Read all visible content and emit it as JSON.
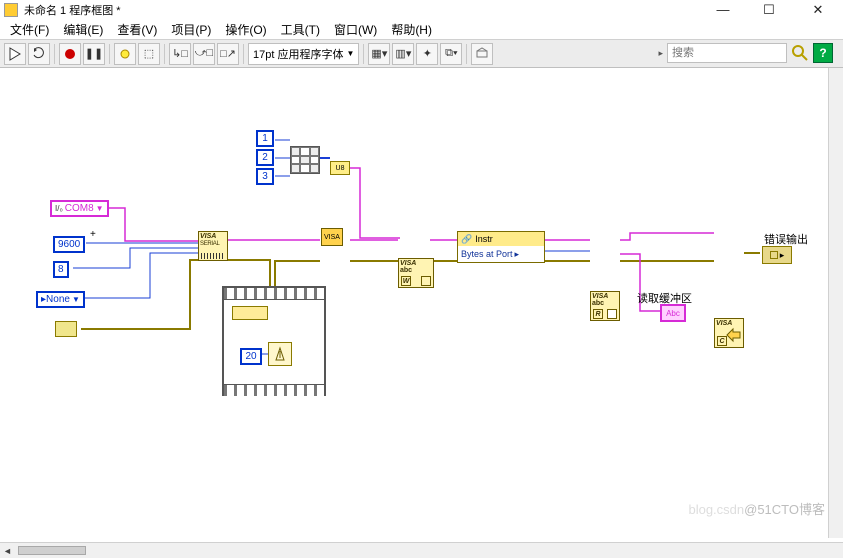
{
  "window": {
    "title": "未命名 1 程序框图 *",
    "min": "—",
    "max": "☐",
    "close": "✕"
  },
  "menu": {
    "file": "文件(F)",
    "edit": "编辑(E)",
    "view": "查看(V)",
    "project": "项目(P)",
    "operate": "操作(O)",
    "tools": "工具(T)",
    "window": "窗口(W)",
    "help": "帮助(H)"
  },
  "toolbar": {
    "font_selector": "17pt 应用程序字体",
    "search_placeholder": "搜索",
    "help_icon": "?"
  },
  "diagram": {
    "resource_control": {
      "prefix": "I/₀",
      "value": "COM8"
    },
    "baud_control": {
      "value": "9600"
    },
    "databits_control": {
      "value": "8"
    },
    "parity_control": {
      "value": "None"
    },
    "array_consts": [
      "1",
      "2",
      "3"
    ],
    "wait_ms": "20",
    "instr_header": "Instr",
    "instr_body": "Bytes at Port",
    "visa_label": "VISA",
    "visa_serial_sub": "SERIAL",
    "visa_write_sub": "W",
    "visa_read_sub": "R",
    "visa_close_sub": "C",
    "visa_abc_sub": "abc",
    "read_buffer_label": "读取缓冲区",
    "read_buffer_box": "Abc",
    "error_out_label": "错误输出",
    "visa_peek": "VISA"
  },
  "watermark": "@51CTO博客",
  "watermark_pre": "blog.csdn"
}
